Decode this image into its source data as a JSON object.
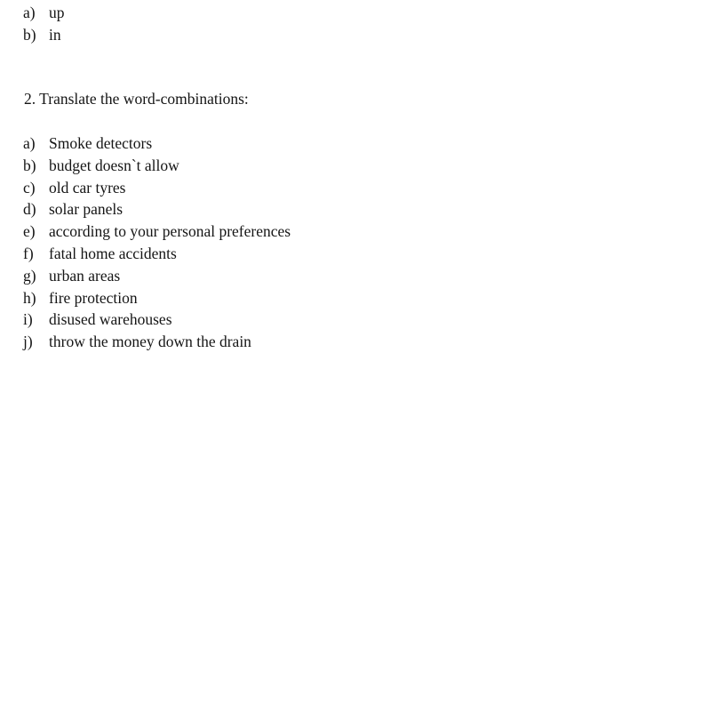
{
  "document": {
    "background_color": "#ffffff",
    "text_color": "#151515"
  },
  "top_list": {
    "items": [
      {
        "marker": "a)",
        "text": "up"
      },
      {
        "marker": "b)",
        "text": "in"
      }
    ]
  },
  "heading": {
    "text": "2. Translate the word-combinations:"
  },
  "main_list": {
    "items": [
      {
        "marker": "a)",
        "text": "Smoke detectors"
      },
      {
        "marker": "b)",
        "text": "budget doesn`t allow"
      },
      {
        "marker": "c)",
        "text": "old car tyres"
      },
      {
        "marker": "d)",
        "text": "solar panels"
      },
      {
        "marker": "e)",
        "text": "according to your personal preferences"
      },
      {
        "marker": "f)",
        "text": "fatal home accidents"
      },
      {
        "marker": "g)",
        "text": "urban areas"
      },
      {
        "marker": "h)",
        "text": "fire protection"
      },
      {
        "marker": "i)",
        "text": "disused warehouses"
      },
      {
        "marker": "j)",
        "text": "throw the money down the drain"
      }
    ]
  }
}
